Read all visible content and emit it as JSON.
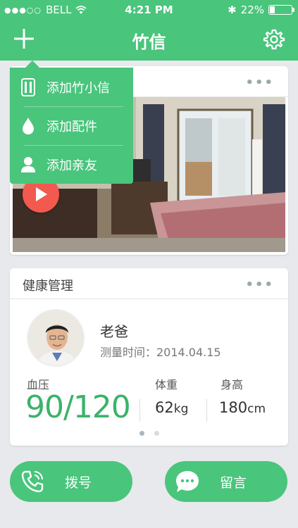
{
  "status_bar": {
    "carrier": "BELL",
    "signal_dots": "●●●○○",
    "time": "4:21 PM",
    "battery_text": "22%",
    "battery_level": 0.22
  },
  "header": {
    "title": "竹信",
    "add_icon": "plus-icon",
    "settings_icon": "gear-icon"
  },
  "add_menu": {
    "items": [
      {
        "label": "添加竹小信",
        "icon": "device-icon"
      },
      {
        "label": "添加配件",
        "icon": "drop-icon"
      },
      {
        "label": "添加亲友",
        "icon": "person-icon"
      }
    ]
  },
  "video_card": {
    "more_icon": "more-dots-icon",
    "play_icon": "play-icon"
  },
  "health_card": {
    "title": "健康管理",
    "name": "老爸",
    "measure_time": "测量时间：2014.04.15",
    "blood_pressure_label": "血压",
    "blood_pressure_value": "90/120",
    "weight_label": "体重",
    "weight_value": "62",
    "weight_unit": "kg",
    "height_label": "身高",
    "height_value": "180",
    "height_unit": "cm",
    "page_count": 2,
    "active_page": 1
  },
  "actions": {
    "dial_label": "拨号",
    "message_label": "留言"
  },
  "colors": {
    "brand_green": "#49c57c",
    "value_green": "#3bb36a",
    "play_red": "#f25a4f"
  }
}
